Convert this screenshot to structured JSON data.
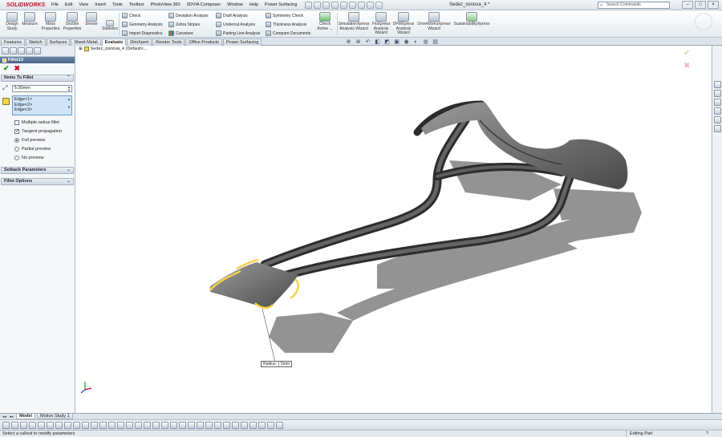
{
  "app": {
    "logo": "SOLIDWORKS",
    "doc_title": "Sedez_osnova_4 *"
  },
  "menu": [
    "File",
    "Edit",
    "View",
    "Insert",
    "Tools",
    "Toolbox",
    "PhotoView 360",
    "3DVIA Composer",
    "Window",
    "Help",
    "Power Surfacing"
  ],
  "search": {
    "placeholder": "Search Commands"
  },
  "ribbon": {
    "big": [
      {
        "label": "Design Study",
        "icon": "design-study-icon"
      },
      {
        "label": "Measure",
        "icon": "measure-icon"
      },
      {
        "label": "Mass Properties",
        "icon": "mass-properties-icon"
      },
      {
        "label": "Section Properties",
        "icon": "section-properties-icon"
      },
      {
        "label": "Sensor",
        "icon": "sensor-icon"
      },
      {
        "label": "Statistics",
        "icon": "statistics-icon"
      }
    ],
    "col1": [
      "Check",
      "Geometry Analysis",
      "Import Diagnostics"
    ],
    "col2": [
      "Deviation Analysis",
      "Zebra Stripes",
      "Curvature"
    ],
    "col3": [
      "Draft Analysis",
      "Undercut Analysis",
      "Parting Line Analysis"
    ],
    "col4": [
      "Symmetry Check",
      "Thickness Analysis",
      "Compare Documents"
    ],
    "check_active": "Check Active ...",
    "xpress": [
      "SimulationXpress Analysis Wizard",
      "FloXpress Analysis Wizard",
      "DFMXpress Analysis Wizard",
      "DriveWorksXpress Wizard",
      "SustainabilityXpress"
    ]
  },
  "tabs": [
    {
      "label": "Features",
      "active": false
    },
    {
      "label": "Sketch",
      "active": false
    },
    {
      "label": "Surfaces",
      "active": false
    },
    {
      "label": "Sheet Metal",
      "active": false
    },
    {
      "label": "Evaluate",
      "active": true
    },
    {
      "label": "DimXpert",
      "active": false
    },
    {
      "label": "Render Tools",
      "active": false
    },
    {
      "label": "Office Products",
      "active": false
    },
    {
      "label": "Power Surfacing",
      "active": false
    }
  ],
  "feature": {
    "title": "Fillet13",
    "items_section": "Items To Fillet",
    "radius": "5.00mm",
    "edges": [
      "Edge<1>",
      "Edge<2>",
      "Edge<3>"
    ],
    "multiple_radius": {
      "label": "Multiple radius fillet",
      "checked": false
    },
    "tangent": {
      "label": "Tangent propagation",
      "checked": true
    },
    "previews": [
      {
        "label": "Full preview",
        "selected": true
      },
      {
        "label": "Partial preview",
        "selected": false
      },
      {
        "label": "No preview",
        "selected": false
      }
    ],
    "setback_section": "Setback Parameters",
    "options_section": "Fillet Options"
  },
  "tree": {
    "item": "Sedez_osnova_4  (Default<..."
  },
  "callout": {
    "label": "Radius:",
    "value": "5mm"
  },
  "bottom_tabs": [
    {
      "label": "Model",
      "active": true
    },
    {
      "label": "Motion Study 1",
      "active": false
    }
  ],
  "status": {
    "message": "Select a callout to modify parameters",
    "state": "Editing Part",
    "help": "?"
  },
  "colors": {
    "accent": "#c8102e",
    "panel_header": "#4c6688",
    "selection": "#f3d34a",
    "model": "#5a5a5a"
  }
}
